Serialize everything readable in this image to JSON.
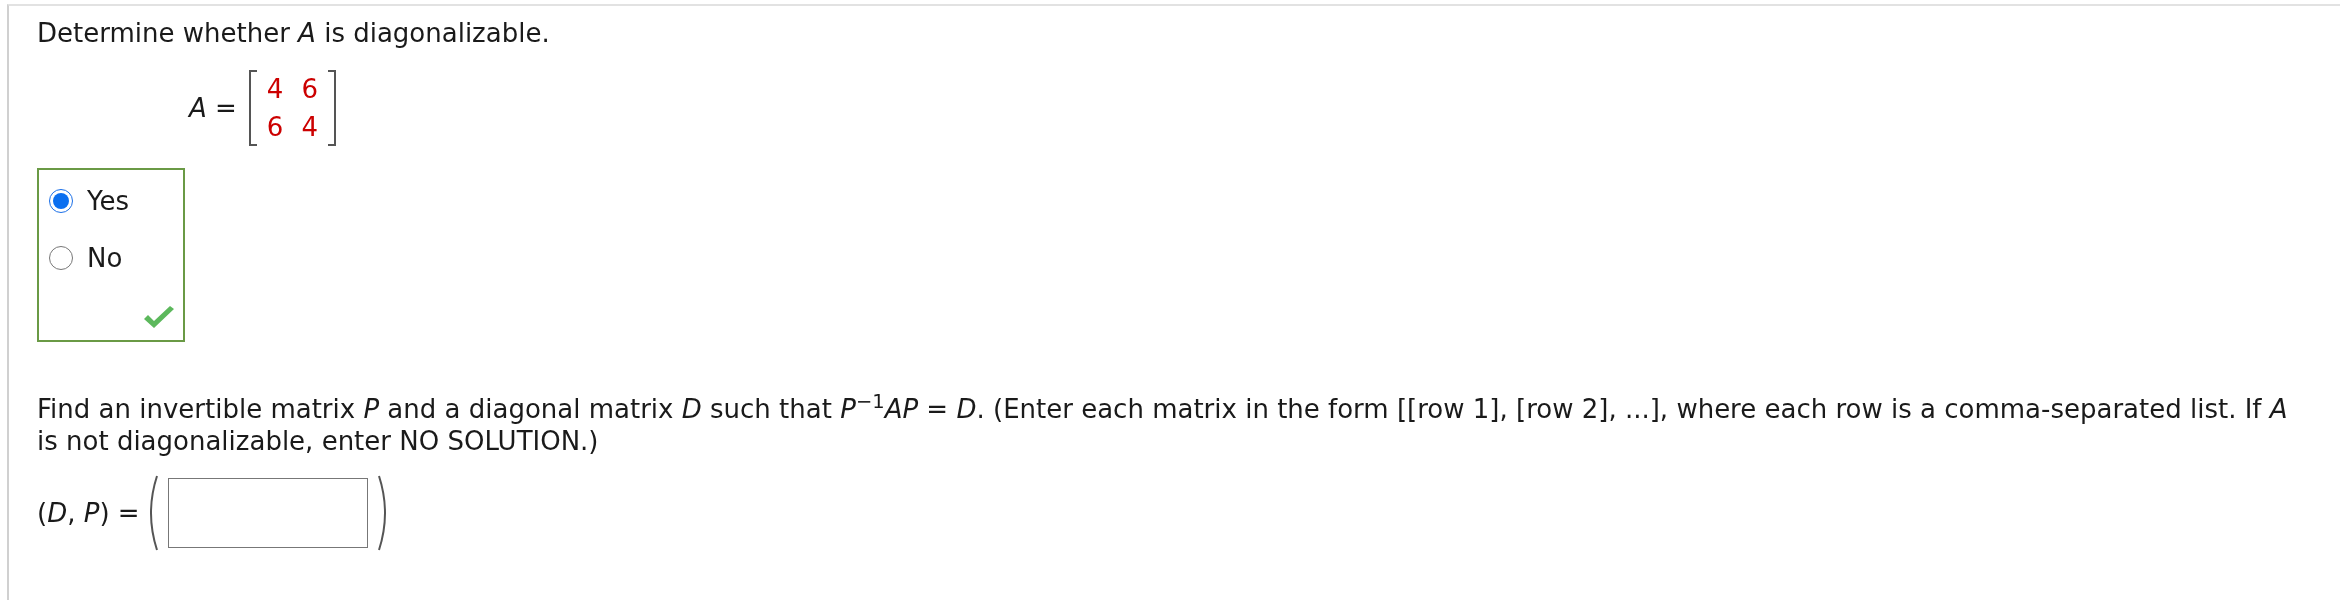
{
  "question": {
    "prompt": "Determine whether *A* is diagonalizable.",
    "equation_label": "*A* =",
    "matrix": [
      [
        "4",
        "6"
      ],
      [
        "6",
        "4"
      ]
    ],
    "choices": [
      {
        "label": "Yes",
        "selected": true
      },
      {
        "label": "No",
        "selected": false
      }
    ],
    "correct": true,
    "instructions": "Find an invertible matrix *P* and a diagonal matrix *D* such that *P*$^{−1}$*AP* = *D*. (Enter each matrix in the form [[row 1], [row 2], ...], where each row is a comma-separated list. If *A* is not diagonalizable, enter NO SOLUTION.)",
    "answer_label": "(*D*, *P*) ="
  }
}
